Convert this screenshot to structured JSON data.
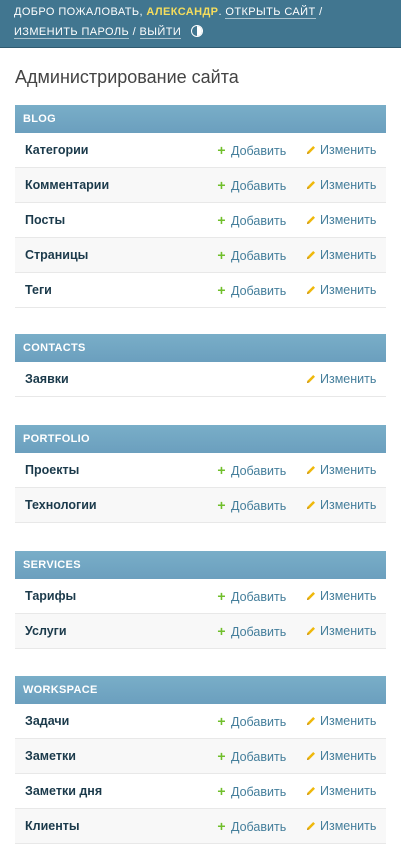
{
  "header": {
    "welcome": "ДОБРО ПОЖАЛОВАТЬ,",
    "username": "АЛЕКСАНДР",
    "open_site": "ОТКРЫТЬ САЙТ",
    "change_password": "ИЗМЕНИТЬ ПАРОЛЬ",
    "logout": "ВЫЙТИ",
    "sep": "/",
    "theme_icon": "theme-toggle-icon"
  },
  "page_title": "Администрирование сайта",
  "colors": {
    "header_bg": "#417690",
    "caption_bg": "#79aec8",
    "username": "#f5dd5d",
    "add_icon": "#70bf2b",
    "change_icon": "#efb80b",
    "link": "#447e9b"
  },
  "actions": {
    "add": "Добавить",
    "change": "Изменить"
  },
  "modules": [
    {
      "caption": "BLOG",
      "rows": [
        {
          "name": "Категории",
          "add": true
        },
        {
          "name": "Комментарии",
          "add": true
        },
        {
          "name": "Посты",
          "add": true
        },
        {
          "name": "Страницы",
          "add": true
        },
        {
          "name": "Теги",
          "add": true
        }
      ]
    },
    {
      "caption": "CONTACTS",
      "rows": [
        {
          "name": "Заявки",
          "add": false
        }
      ]
    },
    {
      "caption": "PORTFOLIO",
      "rows": [
        {
          "name": "Проекты",
          "add": true
        },
        {
          "name": "Технологии",
          "add": true
        }
      ]
    },
    {
      "caption": "SERVICES",
      "rows": [
        {
          "name": "Тарифы",
          "add": true
        },
        {
          "name": "Услуги",
          "add": true
        }
      ]
    },
    {
      "caption": "WORKSPACE",
      "rows": [
        {
          "name": "Задачи",
          "add": true
        },
        {
          "name": "Заметки",
          "add": true
        },
        {
          "name": "Заметки дня",
          "add": true
        },
        {
          "name": "Клиенты",
          "add": true
        }
      ]
    }
  ]
}
